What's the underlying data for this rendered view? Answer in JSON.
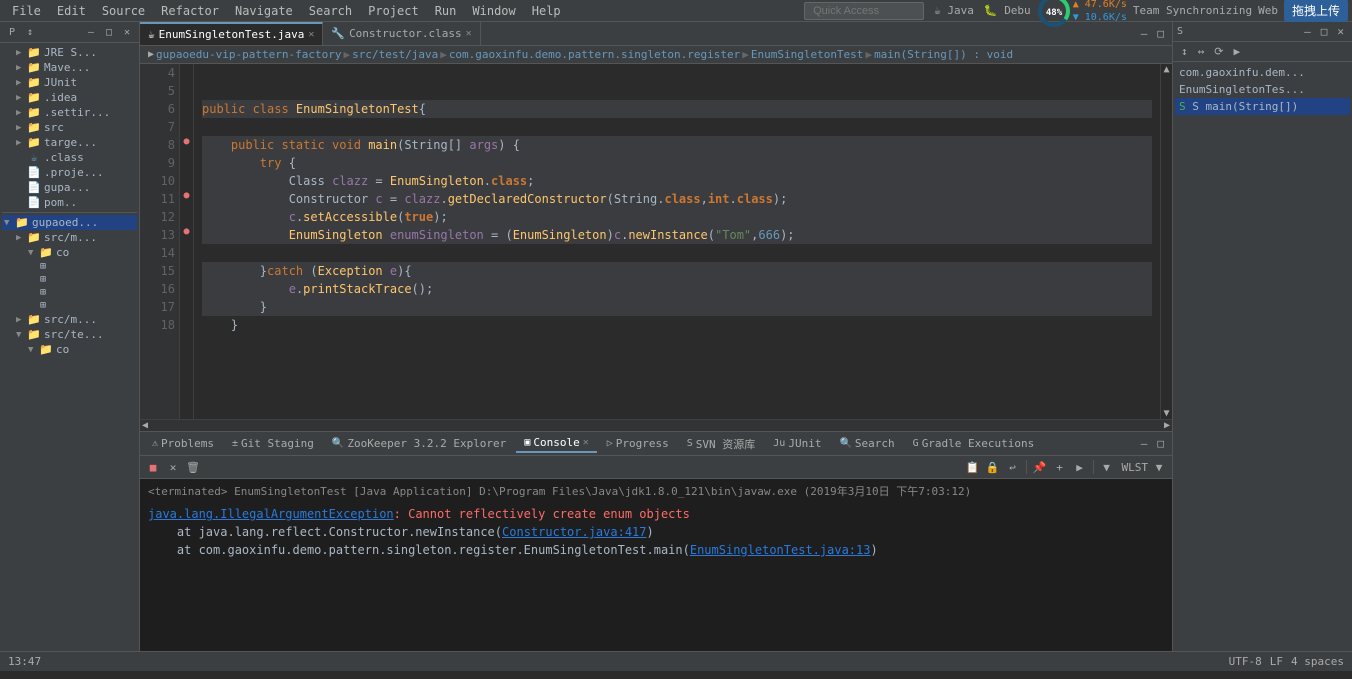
{
  "menubar": {
    "items": [
      "File",
      "Edit",
      "Source",
      "Refactor",
      "Navigate",
      "Search",
      "Project",
      "Run",
      "Window",
      "Help"
    ]
  },
  "toolbar": {
    "quick_access_placeholder": "Quick Access",
    "quick_access_label": "Quick Access"
  },
  "tabs": [
    {
      "label": "EnumSingletonTest.java",
      "active": true,
      "icon": "☕"
    },
    {
      "label": "Constructor.class",
      "active": false,
      "icon": "🔧"
    }
  ],
  "breadcrumb": {
    "items": [
      "gupaoedu-vip-pattern-factory",
      "src/test/java",
      "com.gaoxinfu.demo.pattern.singleton.register",
      "EnumSingletonTest",
      "main(String[]) : void"
    ]
  },
  "code": {
    "lines": [
      {
        "num": 4,
        "content": "",
        "indent": 0
      },
      {
        "num": 5,
        "content": "",
        "indent": 0
      },
      {
        "num": 6,
        "content": "public class EnumSingletonTest {",
        "type": "class"
      },
      {
        "num": 7,
        "content": "",
        "indent": 0
      },
      {
        "num": 8,
        "content": "    public static void main(String[] args) {",
        "type": "method",
        "marker": "●"
      },
      {
        "num": 9,
        "content": "        try {",
        "type": "try"
      },
      {
        "num": 10,
        "content": "            Class clazz = EnumSingleton.class;",
        "type": "code"
      },
      {
        "num": 11,
        "content": "            Constructor c = clazz.getDeclaredConstructor(String.class,int.class);",
        "type": "code",
        "marker": "●"
      },
      {
        "num": 12,
        "content": "            c.setAccessible(true);",
        "type": "code"
      },
      {
        "num": 13,
        "content": "            EnumSingleton enumSingleton = (EnumSingleton)c.newInstance(\"Tom\",666);",
        "type": "code",
        "marker": "●"
      },
      {
        "num": 14,
        "content": "",
        "indent": 0
      },
      {
        "num": 15,
        "content": "        }catch (Exception e){",
        "type": "catch"
      },
      {
        "num": 16,
        "content": "            e.printStackTrace();",
        "type": "code"
      },
      {
        "num": 17,
        "content": "        }",
        "type": "code"
      },
      {
        "num": 18,
        "content": "    }",
        "type": "code"
      }
    ]
  },
  "console": {
    "terminated_label": "<terminated> EnumSingletonTest [Java Application] D:\\Program Files\\Java\\jdk1.8.0_121\\bin\\javaw.exe (2019年3月10日 下午7:03:12)",
    "error_class": "java.lang.IllegalArgumentException",
    "error_message": ": Cannot reflectively create enum objects",
    "stack_trace": [
      "    at java.lang.reflect.Constructor.newInstance(Constructor.java:417)",
      "    at com.gaoxinfu.demo.pattern.singleton.register.EnumSingletonTest.main(EnumSingletonTest.java:13)"
    ],
    "link1": "Constructor.java:417",
    "link2": "EnumSingletonTest.java:13"
  },
  "bottom_tabs": [
    {
      "label": "Problems",
      "icon": "⚠",
      "active": false
    },
    {
      "label": "Git Staging",
      "icon": "±",
      "active": false
    },
    {
      "label": "ZooKeeper 3.2.2 Explorer",
      "icon": "🔍",
      "active": false
    },
    {
      "label": "Console",
      "icon": "▣",
      "active": true
    },
    {
      "label": "Progress",
      "icon": "▷",
      "active": false
    },
    {
      "label": "SVN 资源库",
      "icon": "S",
      "active": false
    },
    {
      "label": "JUnit",
      "icon": "Ju",
      "active": false
    },
    {
      "label": "Search",
      "icon": "🔍",
      "active": false
    },
    {
      "label": "Gradle Executions",
      "icon": "G",
      "active": false
    }
  ],
  "sidebar": {
    "tree_items": [
      {
        "label": "JRE S...",
        "level": 1,
        "type": "folder",
        "expanded": false
      },
      {
        "label": "Mave...",
        "level": 1,
        "type": "folder",
        "expanded": false
      },
      {
        "label": "JUnit",
        "level": 1,
        "type": "folder",
        "expanded": false
      },
      {
        "label": ".idea",
        "level": 1,
        "type": "folder",
        "expanded": false
      },
      {
        "label": ".settir...",
        "level": 1,
        "type": "folder",
        "expanded": false
      },
      {
        "label": "src",
        "level": 1,
        "type": "folder",
        "expanded": false
      },
      {
        "label": "targe...",
        "level": 1,
        "type": "folder",
        "expanded": false
      },
      {
        "label": ".class",
        "level": 1,
        "type": "file",
        "expanded": false
      },
      {
        "label": ".proje...",
        "level": 1,
        "type": "file",
        "expanded": false
      },
      {
        "label": "gupa...",
        "level": 1,
        "type": "file",
        "expanded": false
      },
      {
        "label": "pom..",
        "level": 1,
        "type": "file",
        "expanded": false
      },
      {
        "label": "gupaoed...",
        "level": 0,
        "type": "folder",
        "expanded": true
      },
      {
        "label": "src/m...",
        "level": 1,
        "type": "folder",
        "expanded": false
      },
      {
        "label": "co ▼",
        "level": 2,
        "type": "folder",
        "expanded": true
      },
      {
        "label": "",
        "level": 3,
        "type": "folder"
      },
      {
        "label": "",
        "level": 3,
        "type": "folder"
      },
      {
        "label": "",
        "level": 3,
        "type": "folder"
      },
      {
        "label": "",
        "level": 3,
        "type": "folder"
      },
      {
        "label": "src/m...",
        "level": 1,
        "type": "folder"
      },
      {
        "label": "src/te...",
        "level": 1,
        "type": "folder",
        "expanded": true
      },
      {
        "label": "co ▼",
        "level": 2,
        "type": "folder",
        "expanded": true
      }
    ]
  },
  "right_panel": {
    "items": [
      {
        "label": "com.gaoxinfu.dem..."
      },
      {
        "label": "EnumSingletonTes..."
      },
      {
        "label": "S main(String[])"
      }
    ]
  },
  "status": {
    "cpu_percent": "48%",
    "upload_speed": "47.6K/s",
    "download_speed": "10.6K/s",
    "java_label": "Java",
    "debug_label": "Debu",
    "sync_label": "Team Synchronizing",
    "web_label": "Web",
    "upload_btn": "拖拽上传"
  }
}
